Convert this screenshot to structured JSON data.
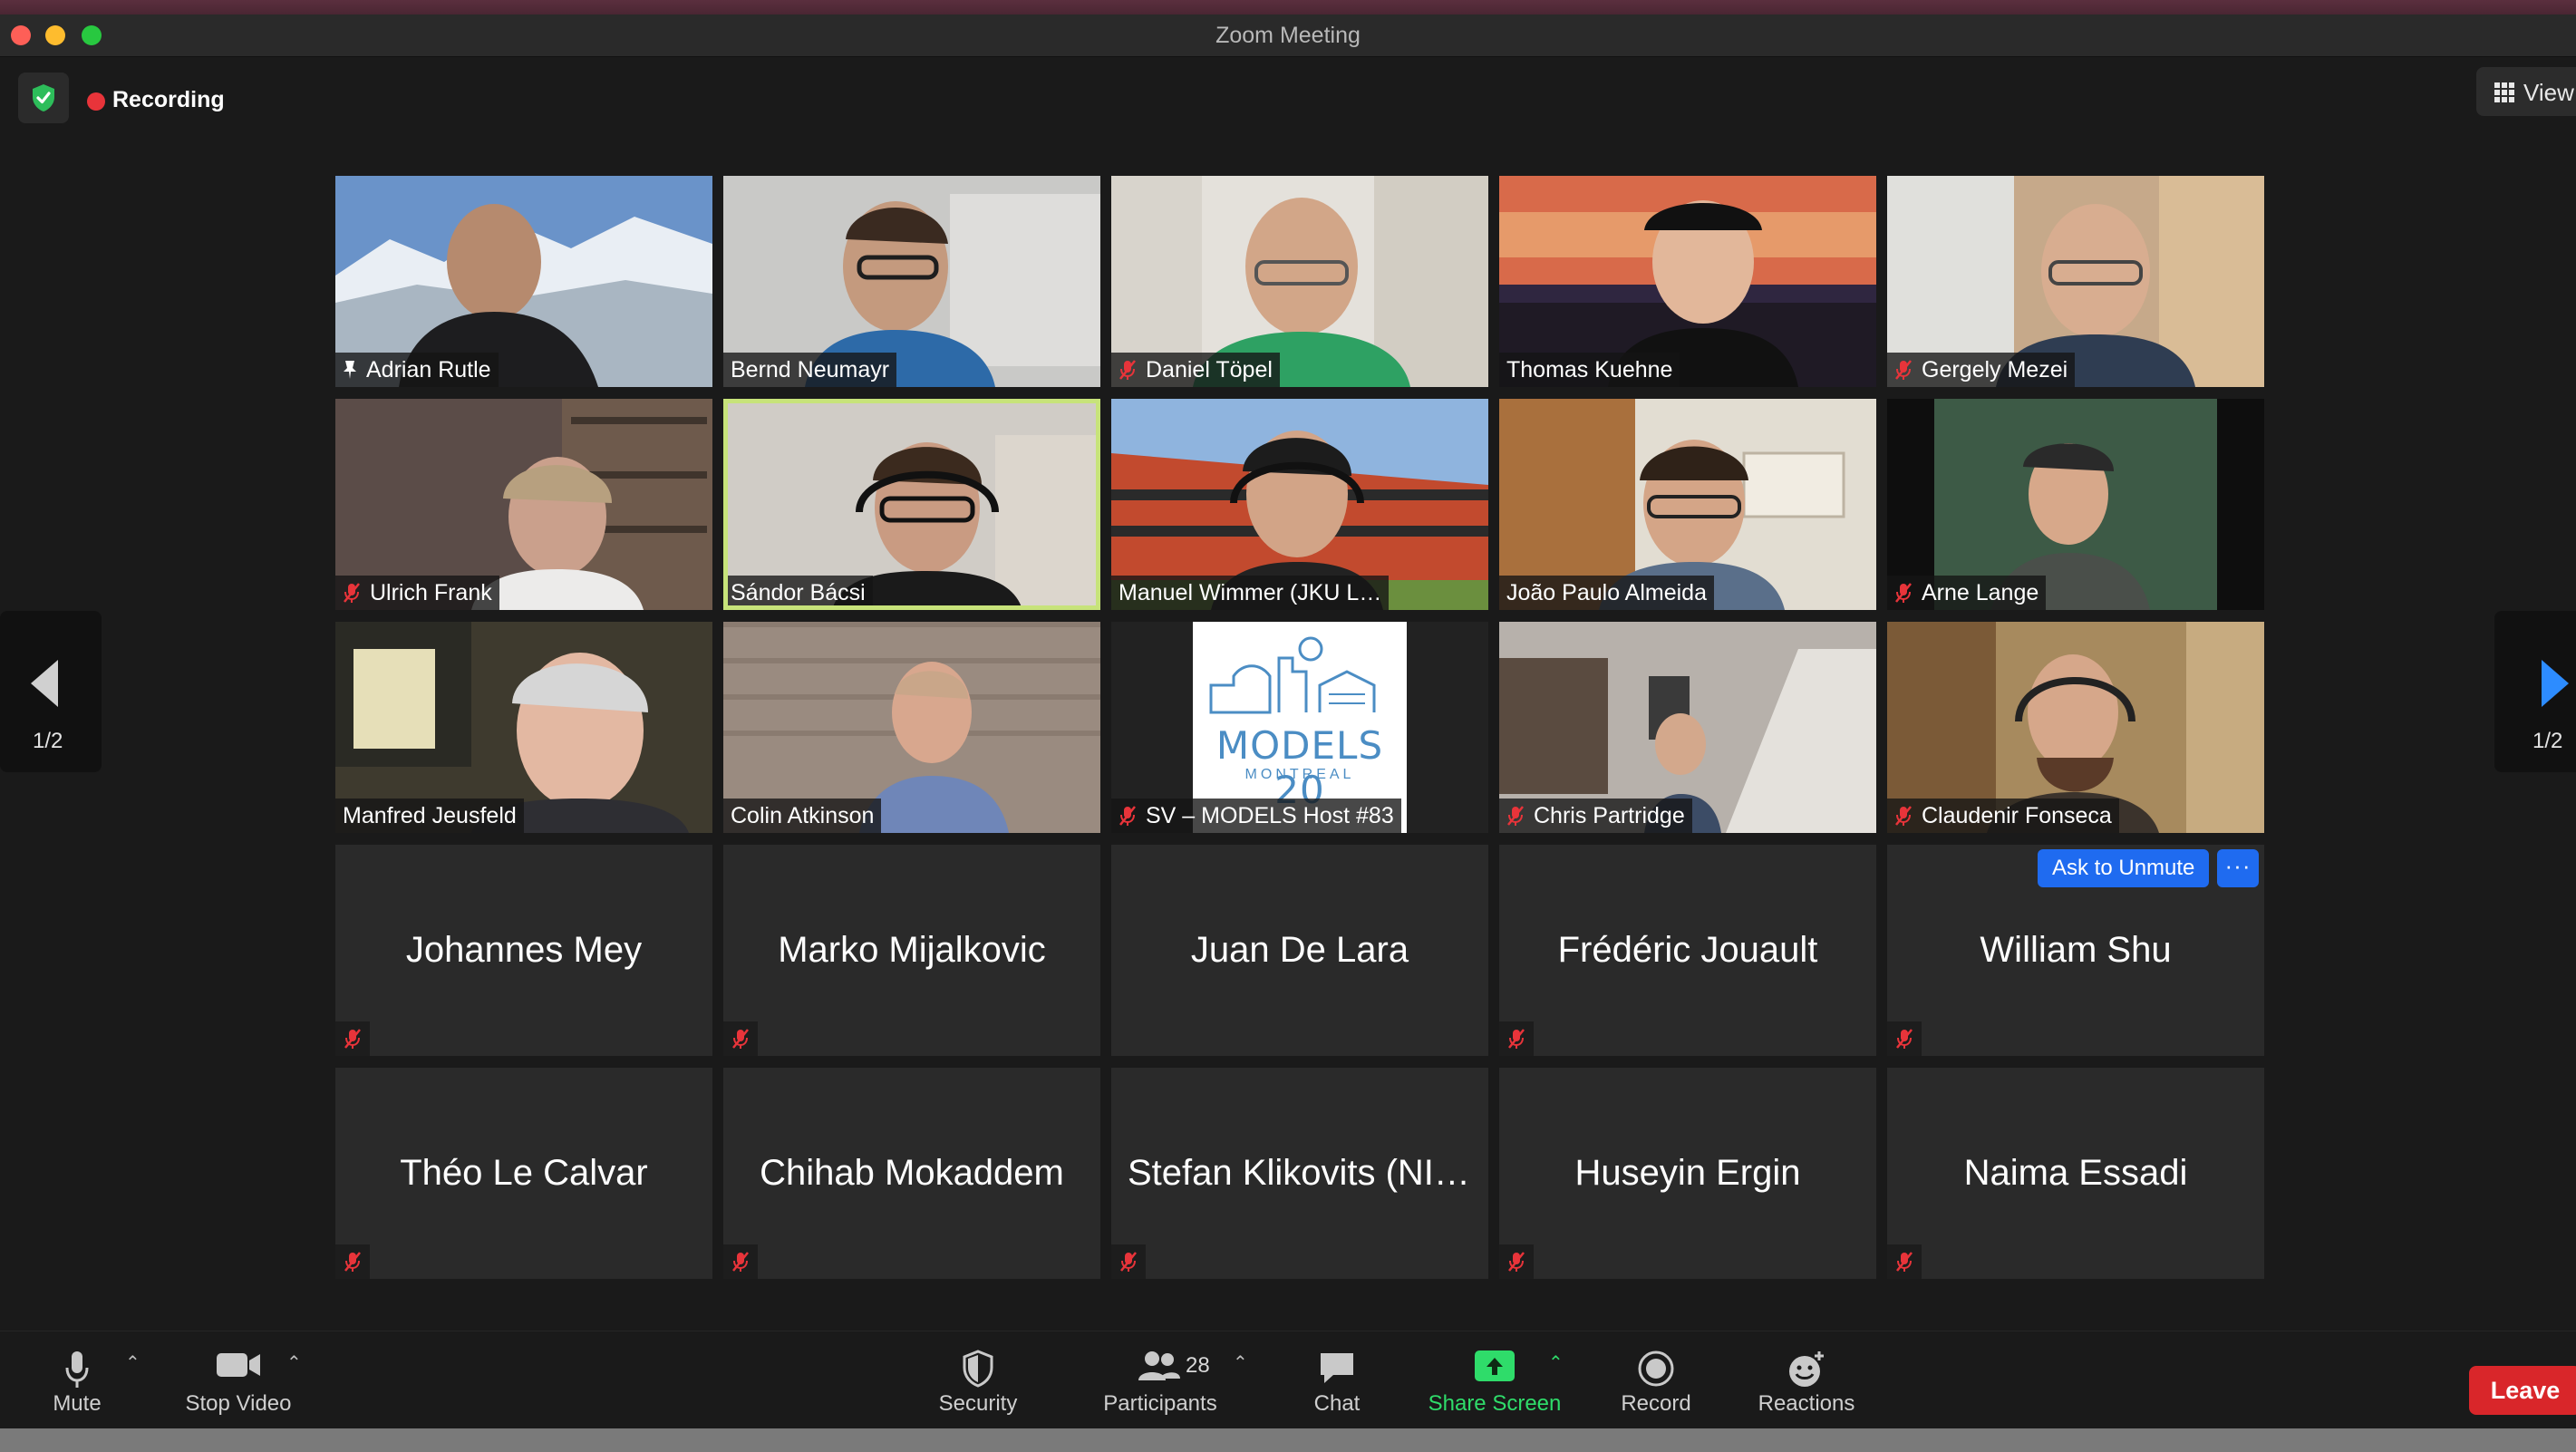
{
  "window": {
    "title": "Zoom Meeting"
  },
  "header": {
    "recording_label": "Recording",
    "view_label": "View"
  },
  "pagination": {
    "left_label": "1/2",
    "right_label": "1/2"
  },
  "grid": {
    "video_tiles": [
      {
        "name": "Adrian Rutle",
        "muted": false,
        "pinned": true
      },
      {
        "name": "Bernd Neumayr",
        "muted": false
      },
      {
        "name": "Daniel Töpel",
        "muted": true
      },
      {
        "name": "Thomas Kuehne",
        "muted": false
      },
      {
        "name": "Gergely Mezei",
        "muted": true
      },
      {
        "name": "Ulrich Frank",
        "muted": true
      },
      {
        "name": "Sándor Bácsi",
        "muted": false,
        "active_speaker": true
      },
      {
        "name": "Manuel Wimmer (JKU L…",
        "muted": false
      },
      {
        "name": "João Paulo Almeida",
        "muted": false
      },
      {
        "name": "Arne Lange",
        "muted": true
      },
      {
        "name": "Manfred Jeusfeld",
        "muted": false
      },
      {
        "name": "Colin Atkinson",
        "muted": false
      },
      {
        "name": "SV – MODELS Host #83",
        "muted": true,
        "logo_text": "MODELS 20",
        "logo_sub": "MONTREAL"
      },
      {
        "name": "Chris Partridge",
        "muted": true
      },
      {
        "name": "Claudenir Fonseca",
        "muted": true
      }
    ],
    "name_tiles": [
      {
        "name": "Johannes Mey",
        "muted": true
      },
      {
        "name": "Marko Mijalkovic",
        "muted": true
      },
      {
        "name": "Juan De Lara",
        "muted": false
      },
      {
        "name": "Frédéric Jouault",
        "muted": true
      },
      {
        "name": "William Shu",
        "muted": true,
        "ask_unmute_label": "Ask to Unmute",
        "more_label": "···"
      },
      {
        "name": "Théo Le Calvar",
        "muted": true
      },
      {
        "name": "Chihab Mokaddem",
        "muted": true
      },
      {
        "name": "Stefan Klikovits (NII,…",
        "muted": true
      },
      {
        "name": "Huseyin Ergin",
        "muted": true
      },
      {
        "name": "Naima Essadi",
        "muted": true
      }
    ]
  },
  "toolbar": {
    "mute_label": "Mute",
    "stop_video_label": "Stop Video",
    "security_label": "Security",
    "participants_label": "Participants",
    "participants_count": "28",
    "chat_label": "Chat",
    "share_screen_label": "Share Screen",
    "record_label": "Record",
    "reactions_label": "Reactions",
    "leave_label": "Leave"
  },
  "colors": {
    "share_green": "#2fdc6a",
    "leave_red": "#d9262a",
    "active_speaker_border": "#c7e37a",
    "ask_unmute_blue": "#1f6bf0",
    "recording_red": "#e8343a"
  }
}
